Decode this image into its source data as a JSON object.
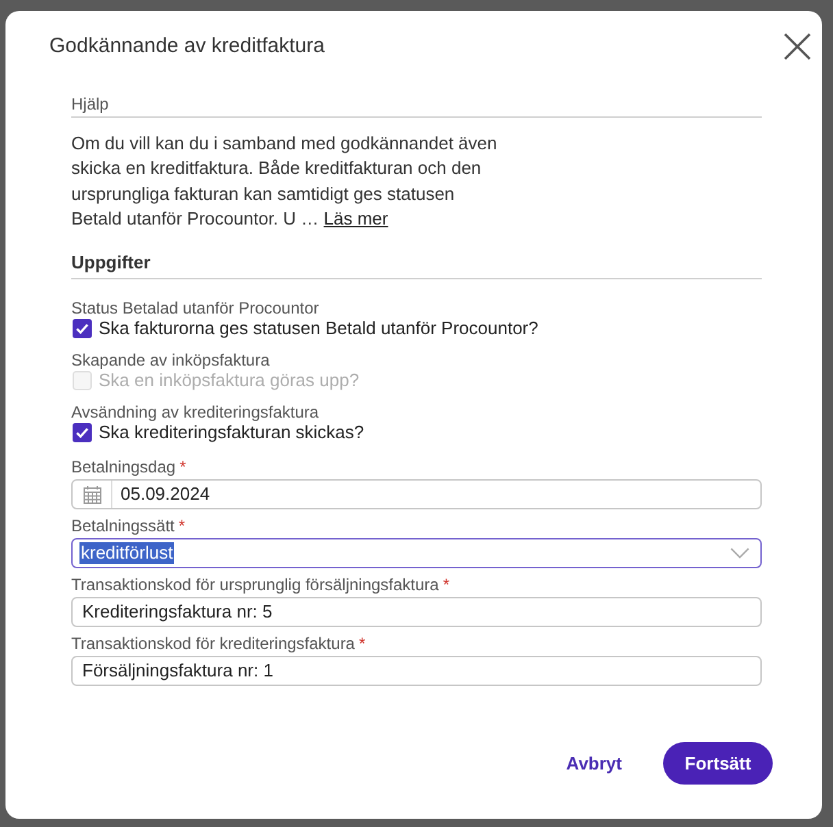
{
  "dialog": {
    "title": "Godkännande av kreditfaktura"
  },
  "help": {
    "heading": "Hjälp",
    "text": "Om du vill kan du i samband med godkännandet även skicka en kreditfaktura. Både kreditfakturan och den ursprungliga fakturan kan samtidigt ges statusen Betald utanför Procountor. U …",
    "link": "Läs mer"
  },
  "tasks": {
    "heading": "Uppgifter",
    "items": [
      {
        "label": "Status Betalad utanför Procountor",
        "option": "Ska fakturorna ges statusen Betald utanför Procountor?",
        "checked": true,
        "disabled": false
      },
      {
        "label": "Skapande av inköpsfaktura",
        "option": "Ska en inköpsfaktura göras upp?",
        "checked": false,
        "disabled": true
      },
      {
        "label": "Avsändning av krediteringsfaktura",
        "option": "Ska krediteringsfakturan skickas?",
        "checked": true,
        "disabled": false
      }
    ]
  },
  "fields": [
    {
      "kind": "date",
      "label": "Betalningsdag",
      "required_mark": "*",
      "value": "05.09.2024",
      "focused": false,
      "value_selected": false
    },
    {
      "kind": "select",
      "label": "Betalningssätt",
      "required_mark": "*",
      "value": "kreditförlust",
      "focused": true,
      "value_selected": true
    },
    {
      "kind": "text",
      "label": "Transaktionskod för ursprunglig försäljningsfaktura",
      "required_mark": "*",
      "value": "Krediteringsfaktura nr: 5",
      "focused": false,
      "value_selected": false
    },
    {
      "kind": "text",
      "label": "Transaktionskod för krediteringsfaktura",
      "required_mark": "*",
      "value": "Försäljningsfaktura nr: 1",
      "focused": false,
      "value_selected": false
    }
  ],
  "buttons": [
    {
      "kind": "text",
      "label": "Avbryt"
    },
    {
      "kind": "primary",
      "label": "Fortsätt"
    }
  ]
}
